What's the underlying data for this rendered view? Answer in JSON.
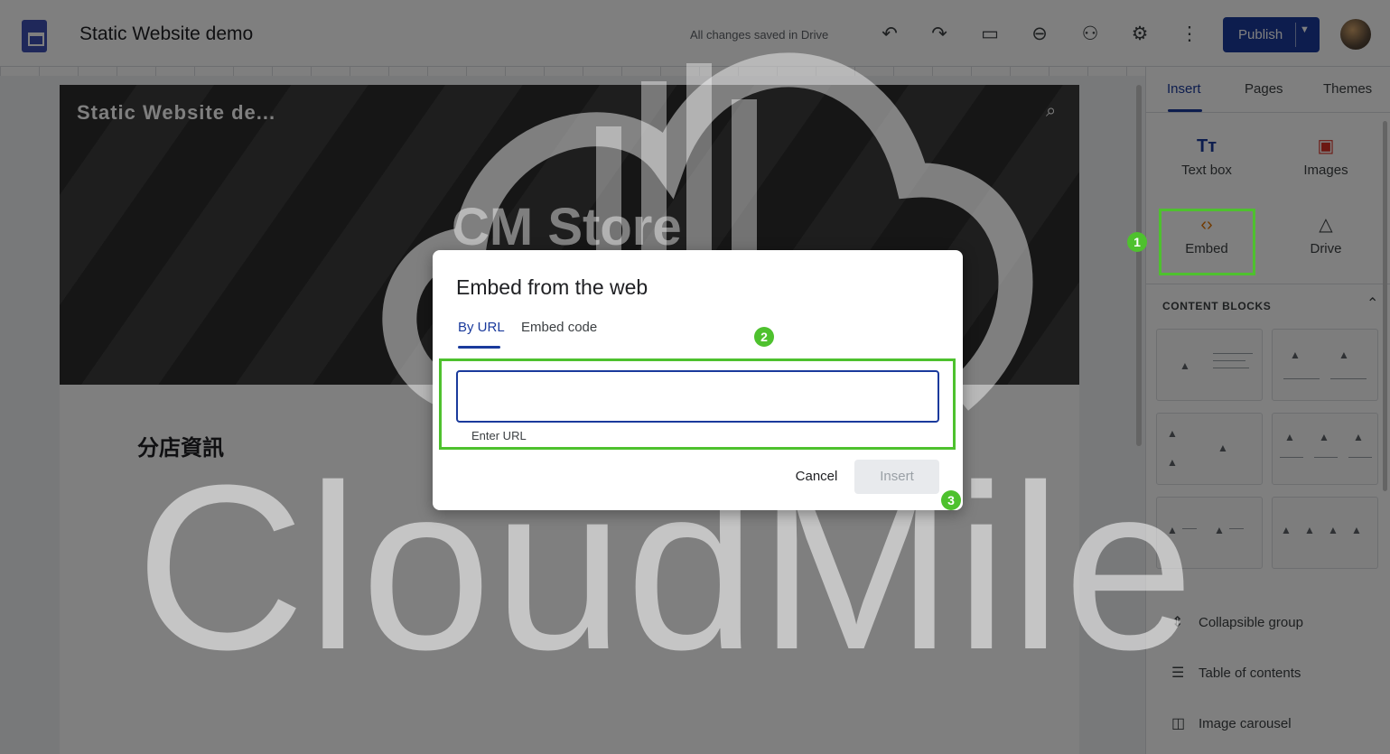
{
  "header": {
    "doc_title": "Static Website demo",
    "save_status": "All changes saved in Drive",
    "publish_label": "Publish",
    "icons": [
      "undo-icon",
      "redo-icon",
      "preview-icon",
      "link-icon",
      "share-icon",
      "settings-icon",
      "more-icon"
    ]
  },
  "site": {
    "name": "Static Website de...",
    "hero_title": "CM Store",
    "section_heading": "分店資訊"
  },
  "panel": {
    "tabs": [
      "Insert",
      "Pages",
      "Themes"
    ],
    "insert_items": [
      "Text box",
      "Images",
      "Embed",
      "Drive"
    ],
    "content_blocks_label": "CONTENT BLOCKS",
    "list_items": [
      "Collapsible group",
      "Table of contents",
      "Image carousel"
    ]
  },
  "dialog": {
    "title": "Embed from the web",
    "tabs": [
      "By URL",
      "Embed code"
    ],
    "url_value": "",
    "url_helper": "Enter URL",
    "cancel_label": "Cancel",
    "insert_label": "Insert"
  },
  "annotations": [
    "1",
    "2",
    "3"
  ],
  "watermark": "CloudMile",
  "colors": {
    "accent": "#1a3a9c",
    "highlight": "#4ec12e",
    "embed_icon": "#e37400"
  }
}
